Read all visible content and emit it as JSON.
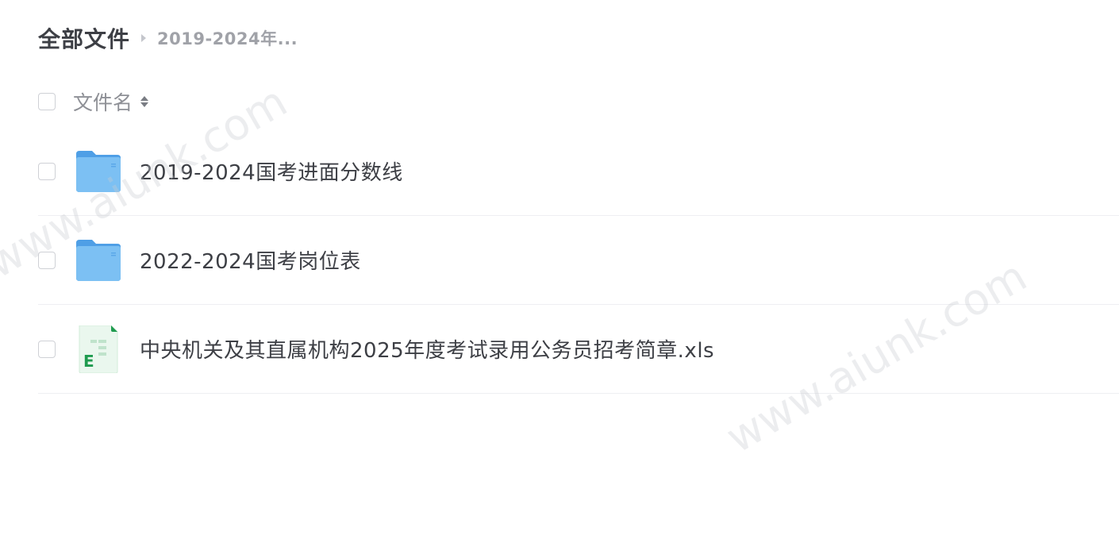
{
  "breadcrumb": {
    "root": "全部文件",
    "current": "2019-2024年..."
  },
  "list_header": {
    "name_column": "文件名"
  },
  "files": [
    {
      "name": "2019-2024国考进面分数线",
      "type": "folder",
      "icon": "folder-icon"
    },
    {
      "name": "2022-2024国考岗位表",
      "type": "folder",
      "icon": "folder-icon"
    },
    {
      "name": "中央机关及其直属机构2025年度考试录用公务员招考简章.xls",
      "type": "excel",
      "icon": "excel-file-icon"
    }
  ],
  "watermark": {
    "text": "www.aiunk.com"
  },
  "colors": {
    "folder": "#6fb5ef",
    "excel_accent": "#1f9b4f"
  }
}
